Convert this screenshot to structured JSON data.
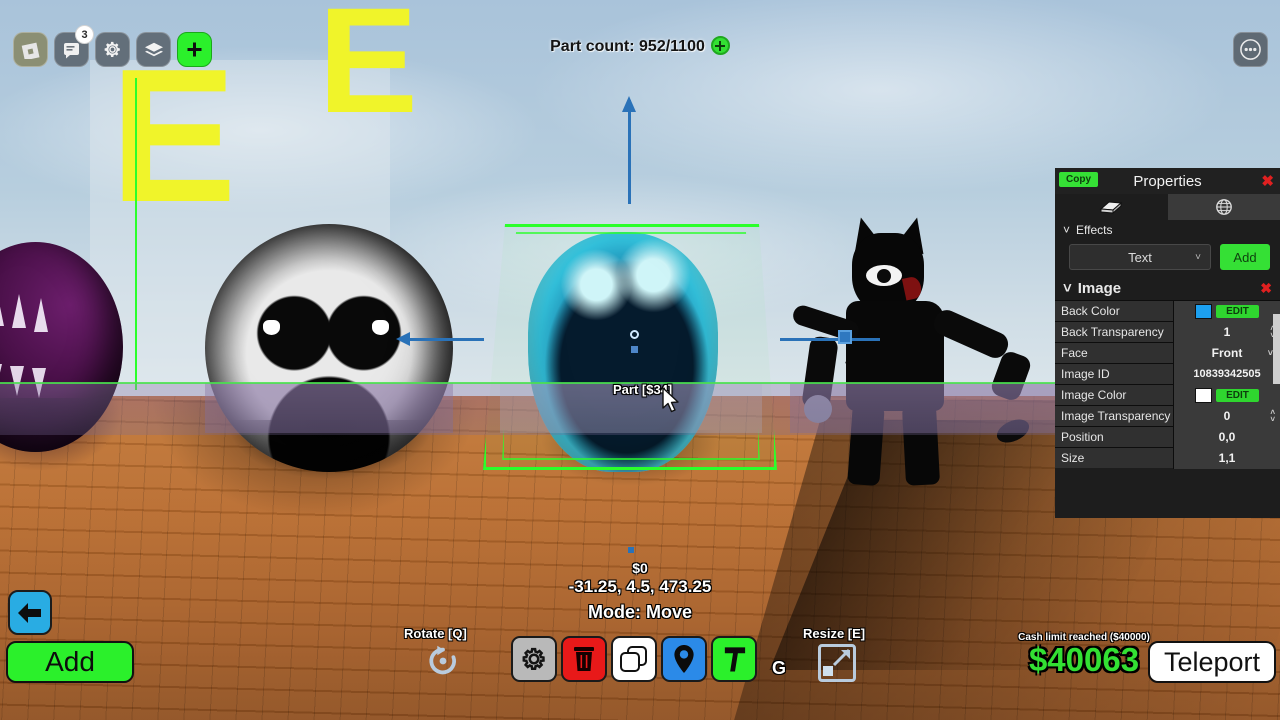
{
  "topbar": {
    "roblox_icon": "roblox-logo-icon",
    "chat_icon": "chat-icon",
    "chat_badge": "3",
    "settings_icon": "gear-icon",
    "layers_icon": "layers-icon",
    "add_icon": "plus-icon",
    "more_icon": "more-dots-icon",
    "part_count_label": "Part count: 952/1100"
  },
  "properties": {
    "copy_label": "Copy",
    "title": "Properties",
    "close_label": "✖",
    "tab_part_icon": "brick-icon",
    "tab_world_icon": "globe-icon",
    "effects_section": "Effects",
    "effects_dropdown_value": "Text",
    "effects_add_label": "Add",
    "image_section": "Image",
    "image_close_label": "✖",
    "rows": [
      {
        "key": "Back Color",
        "value": "",
        "type": "color",
        "color": "#1ca0f0",
        "edit": "EDIT"
      },
      {
        "key": "Back Transparency",
        "value": "1",
        "type": "spinner"
      },
      {
        "key": "Face",
        "value": "Front",
        "type": "dropdown"
      },
      {
        "key": "Image ID",
        "value": "10839342505",
        "type": "text"
      },
      {
        "key": "Image Color",
        "value": "",
        "type": "color",
        "color": "#ffffff",
        "edit": "EDIT"
      },
      {
        "key": "Image Transparency",
        "value": "0",
        "type": "spinner"
      },
      {
        "key": "Position",
        "value": "0,0",
        "type": "text"
      },
      {
        "key": "Size",
        "value": "1,1",
        "type": "text"
      }
    ]
  },
  "scene": {
    "part_label": "Part [$34]",
    "graffiti_1": "E",
    "graffiti_2": "E"
  },
  "hud": {
    "cash_delta": "$0",
    "coordinates": "-31.25, 4.5, 473.25",
    "mode": "Mode: Move",
    "back_icon": "back-arrow-icon",
    "add_label": "Add",
    "rotate_label": "Rotate [Q]",
    "rotate_icon": "rotate-icon",
    "resize_label": "Resize [E]",
    "resize_icon": "resize-icon",
    "grid_key": "G",
    "tools": [
      {
        "name": "settings",
        "icon": "gear-icon"
      },
      {
        "name": "delete",
        "icon": "trash-icon"
      },
      {
        "name": "copy",
        "icon": "duplicate-icon"
      },
      {
        "name": "anchor",
        "icon": "location-pin-icon"
      },
      {
        "name": "build",
        "icon": "hammer-icon"
      }
    ],
    "cash_limit_note": "Cash limit reached ($40000)",
    "cash_amount": "$40063",
    "teleport_label": "Teleport"
  },
  "colors": {
    "accent_green": "#2bf02b",
    "selection_green": "#2bff2b",
    "panel_bg": "#1d1d1d",
    "blue_button": "#29ace3",
    "cash_green": "#33e033"
  }
}
